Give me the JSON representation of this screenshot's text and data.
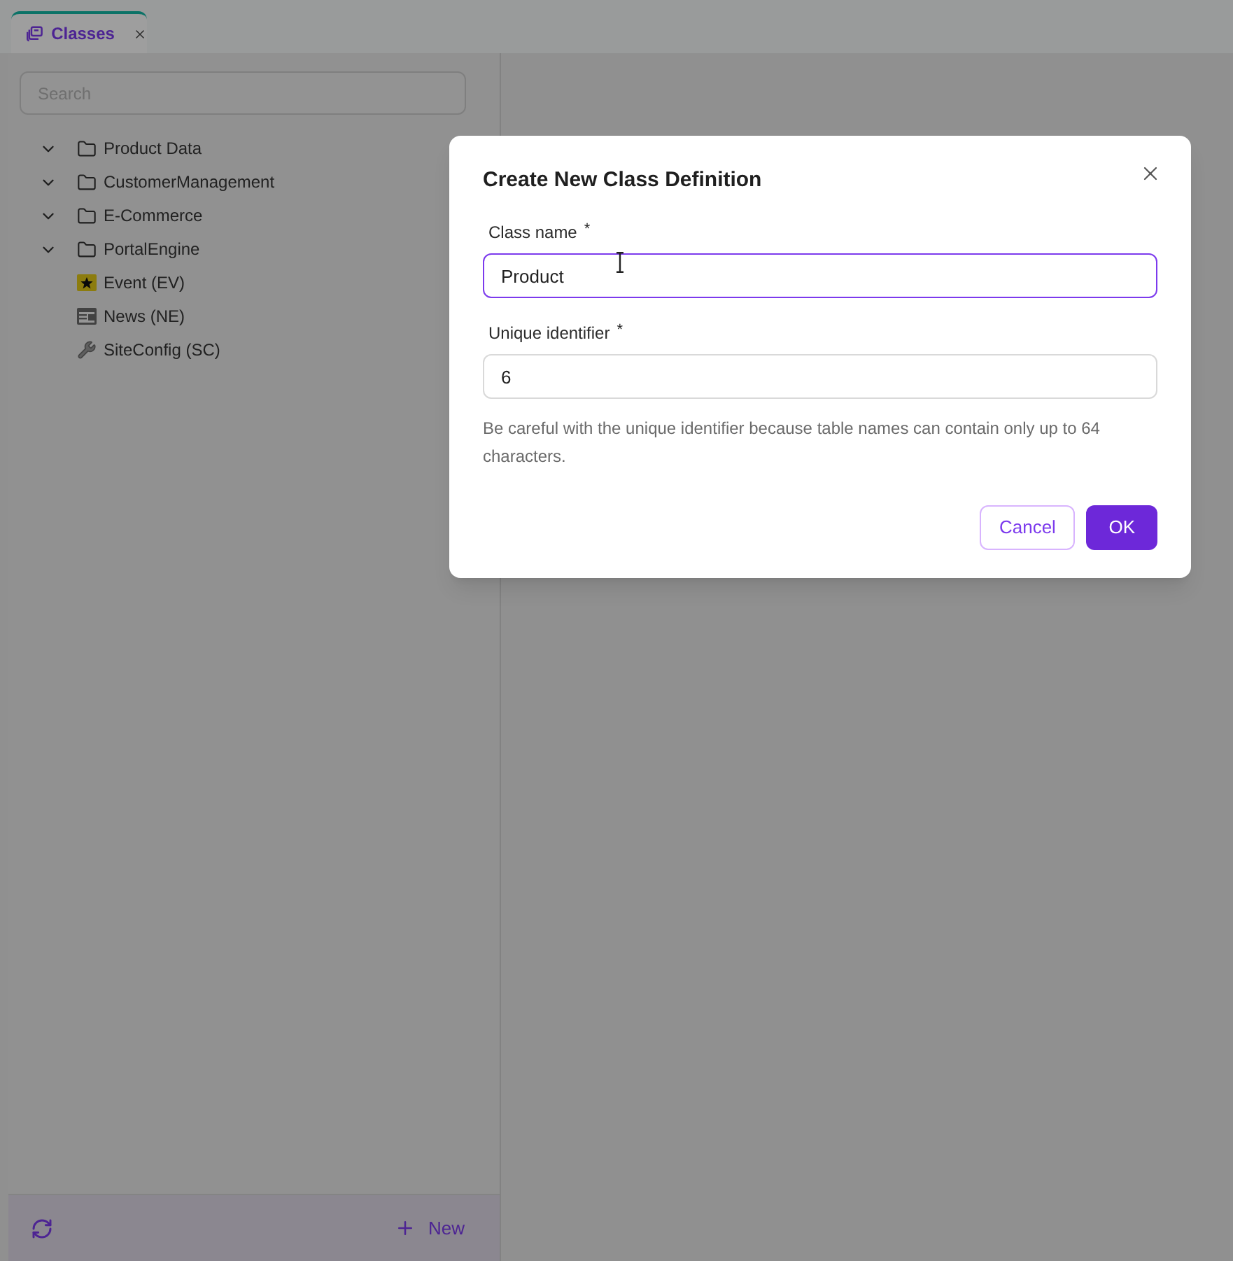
{
  "tabs": [
    {
      "label": "Classes",
      "selected": true
    }
  ],
  "sidebar": {
    "search": {
      "placeholder": "Search"
    },
    "tree": [
      {
        "kind": "folder",
        "label": "Product Data"
      },
      {
        "kind": "folder",
        "label": "CustomerManagement"
      },
      {
        "kind": "folder",
        "label": "E-Commerce"
      },
      {
        "kind": "folder",
        "label": "PortalEngine"
      },
      {
        "kind": "star",
        "label": "Event (EV)"
      },
      {
        "kind": "news",
        "label": "News (NE)"
      },
      {
        "kind": "wrench",
        "label": "SiteConfig (SC)"
      }
    ],
    "footer": {
      "new_button": {
        "label": "New"
      }
    }
  },
  "dialog": {
    "title": "Create New Class Definition",
    "fields": [
      {
        "label": "Class name",
        "required_mark": "*",
        "value": "Product",
        "focused": true
      },
      {
        "label": "Unique identifier",
        "required_mark": "*",
        "value": "6",
        "focused": false
      }
    ],
    "hint": "Be careful with the unique identifier because table names can contain only up to 64 characters.",
    "buttons": [
      {
        "label": "Cancel",
        "kind": "secondary"
      },
      {
        "label": "OK",
        "kind": "primary"
      }
    ]
  }
}
